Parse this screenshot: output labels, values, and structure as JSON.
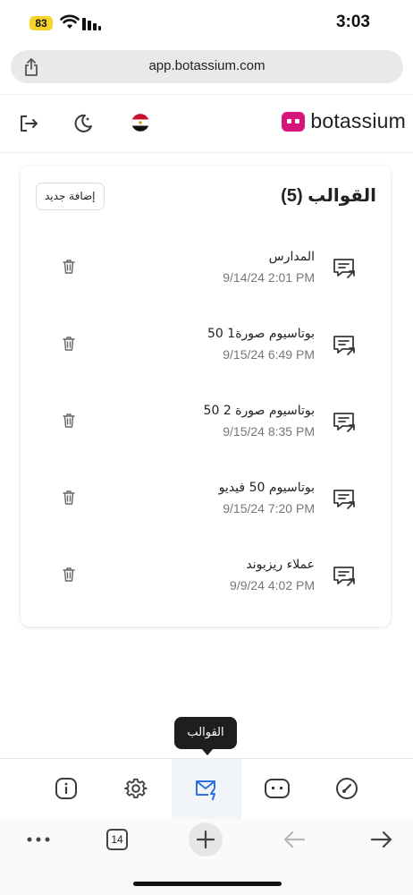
{
  "status_bar": {
    "battery": "83",
    "time": "3:03"
  },
  "browser": {
    "url": "app.botassium.com",
    "tab_count": "14"
  },
  "header": {
    "brand_name": "botassium"
  },
  "templates": {
    "title": "القوالب (5)",
    "add_button": "إضافة جديد",
    "items": [
      {
        "name": "المدارس",
        "date": "9/14/24 2:01 PM"
      },
      {
        "name": "بوتاسيوم صورة1 50",
        "date": "9/15/24 6:49 PM"
      },
      {
        "name": "بوتاسيوم صورة 2 50",
        "date": "9/15/24 8:35 PM"
      },
      {
        "name": "بوتاسيوم 50 فيديو",
        "date": "9/15/24 7:20 PM"
      },
      {
        "name": "عملاء ريزبوند",
        "date": "9/9/24 4:02 PM"
      }
    ]
  },
  "tooltip": {
    "text": "القوالب"
  },
  "colors": {
    "brand": "#d6157a",
    "active_nav": "#2f6fe0",
    "icon": "#3a3a3a"
  }
}
